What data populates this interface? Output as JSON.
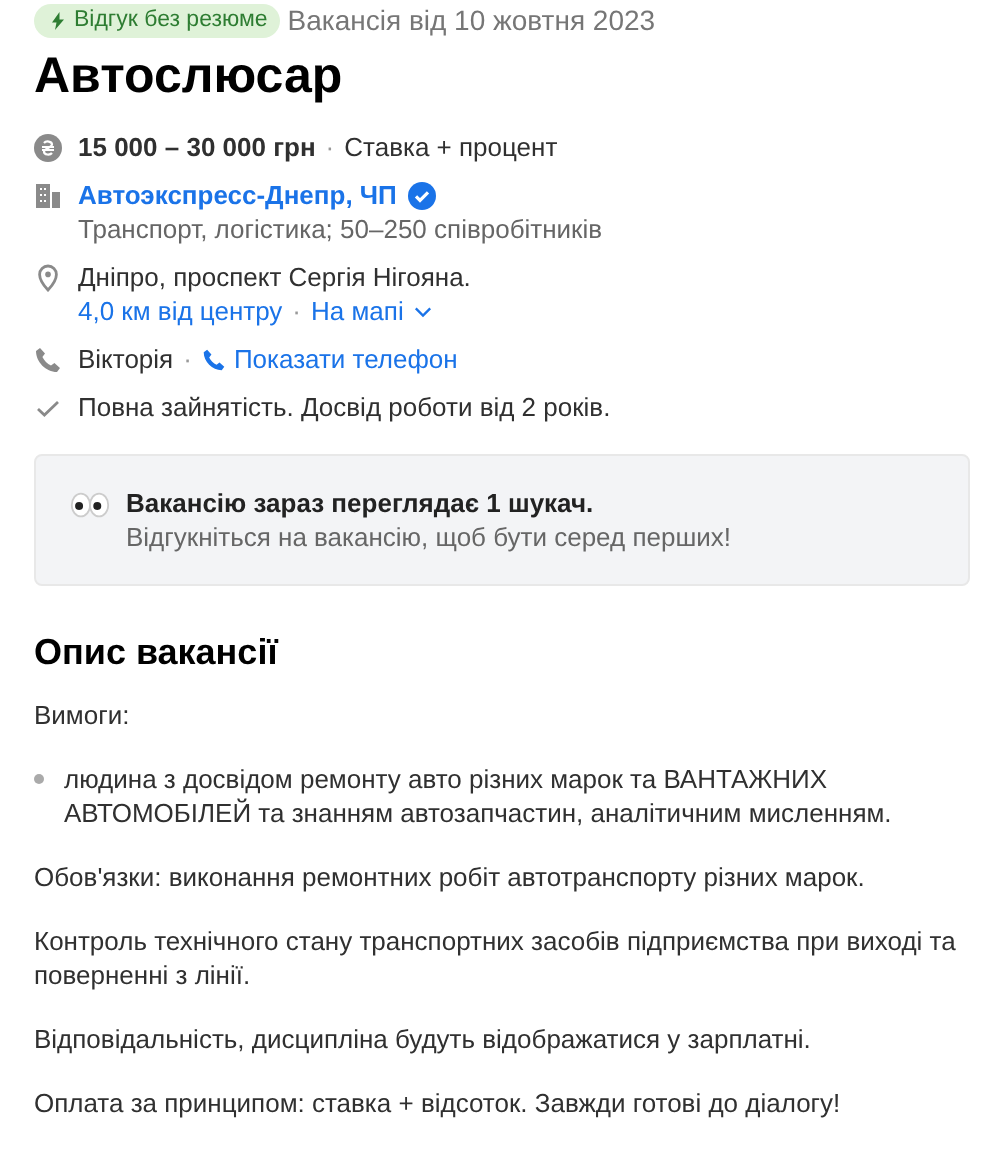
{
  "badge": {
    "label": "Відгук без резюме"
  },
  "posted": "Вакансія від 10 жовтня 2023",
  "title": "Автослюсар",
  "salary": {
    "amount": "15 000 – 30 000 грн",
    "separator": "·",
    "note": "Ставка + процент"
  },
  "company": {
    "name": "Автоэкспресс-Днепр, ЧП",
    "verified": true,
    "info": "Транспорт, логістика; 50–250 співробітників"
  },
  "location": {
    "address": "Дніпро, проспект Сергія Нігояна.",
    "distance": "4,0 км від центру",
    "separator": "·",
    "map_link": "На мапі"
  },
  "contact": {
    "name": "Вікторія",
    "separator": "·",
    "phone_link": "Показати телефон"
  },
  "employment": "Повна зайнятість. Досвід роботи від 2 років.",
  "notice": {
    "title": "Вакансію зараз переглядає 1 шукач.",
    "text": "Відгукніться на вакансію, щоб бути серед перших!"
  },
  "description": {
    "heading": "Опис вакансії",
    "blocks": [
      {
        "kind": "text",
        "text": "Вимоги:"
      },
      {
        "kind": "bullet",
        "text": "людина з досвідом ремонту авто різних марок та ВАНТАЖНИХ АВТОМОБІЛЕЙ та знанням автозапчастин, аналітичним мисленням."
      },
      {
        "kind": "text",
        "text": "Обов'язки: виконання ремонтних робіт автотранспорту різних марок."
      },
      {
        "kind": "text",
        "text": "Контроль технічного стану транспортних засобів підприємства при виході та поверненні з лінії."
      },
      {
        "kind": "text",
        "text": "Відповідальність, дисципліна будуть відображатися у зарплатні."
      },
      {
        "kind": "text",
        "text": "Оплата за принципом: ставка + відсоток. Завжди готові до діалогу!"
      }
    ]
  }
}
